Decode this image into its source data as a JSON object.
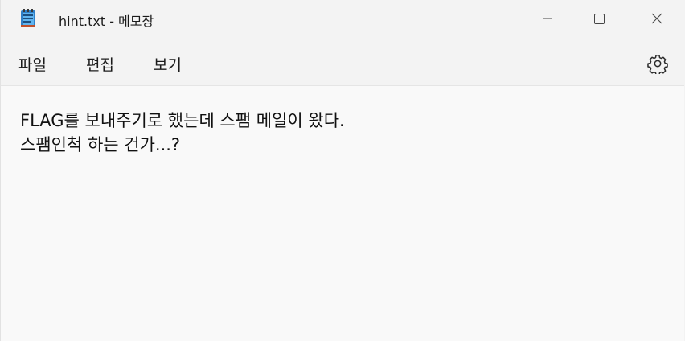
{
  "window": {
    "title": "hint.txt - 메모장"
  },
  "menu": {
    "items": [
      "파일",
      "편집",
      "보기"
    ]
  },
  "editor": {
    "lines": [
      "FLAG를 보내주기로 했는데 스팸 메일이 왔다.",
      "스팸인척 하는 건가...?"
    ]
  },
  "icons": {
    "app": "notepad-icon",
    "minimize": "minimize-icon",
    "maximize": "maximize-icon",
    "close": "close-icon",
    "settings": "gear-icon"
  }
}
